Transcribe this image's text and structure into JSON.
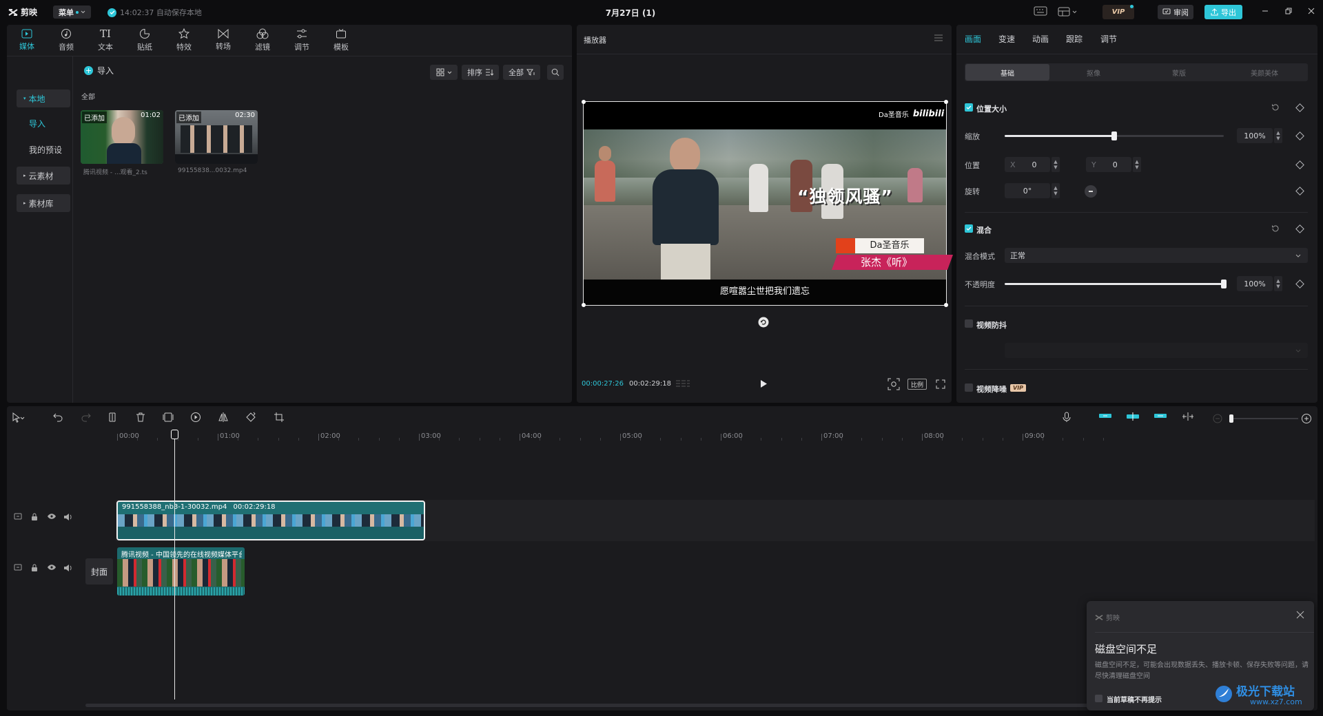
{
  "app": {
    "logo_text": "剪映",
    "menu_label": "菜单",
    "autosave_text": "14:02:37 自动保存本地",
    "project_title": "7月27日 (1)",
    "vip_label": "VIP",
    "review_label": "审阅",
    "export_label": "导出"
  },
  "toolbar": {
    "items": [
      {
        "label": "媒体",
        "icon": "media-icon"
      },
      {
        "label": "音频",
        "icon": "audio-icon"
      },
      {
        "label": "文本",
        "icon": "text-icon"
      },
      {
        "label": "贴纸",
        "icon": "sticker-icon"
      },
      {
        "label": "特效",
        "icon": "effects-icon"
      },
      {
        "label": "转场",
        "icon": "transition-icon"
      },
      {
        "label": "滤镜",
        "icon": "filter-icon"
      },
      {
        "label": "调节",
        "icon": "adjust-icon"
      },
      {
        "label": "模板",
        "icon": "template-icon"
      }
    ]
  },
  "sidebar": {
    "local": "本地",
    "import": "导入",
    "presets": "我的预设",
    "cloud": "云素材",
    "library": "素材库"
  },
  "media": {
    "import_label": "导入",
    "sort_label": "排序",
    "filter_label": "全部",
    "section_label": "全部",
    "items": [
      {
        "badge": "已添加",
        "duration": "01:02",
        "name": "腾讯视频 - ...观看_2.ts"
      },
      {
        "badge": "已添加",
        "duration": "02:30",
        "name": "99155838...0032.mp4"
      }
    ]
  },
  "player": {
    "title": "播放器",
    "current_time": "00:00:27:26",
    "total_time": "00:02:29:18",
    "ratio_label": "比例",
    "watermark_brand": "Da圣音乐",
    "watermark_site": "bilibili",
    "caption_main": "“独领风骚”",
    "caption_brand": "Da圣音乐",
    "caption_song": "张杰《听》",
    "subtitle": "愿喧嚣尘世把我们遗忘"
  },
  "props": {
    "tabs": [
      "画面",
      "变速",
      "动画",
      "跟踪",
      "调节"
    ],
    "subtabs": [
      "基础",
      "抠像",
      "蒙版",
      "美颜美体"
    ],
    "position_size": {
      "title": "位置大小",
      "scale_label": "缩放",
      "scale_value": "100%",
      "scale_level": 0.5,
      "pos_label": "位置",
      "x_label": "X",
      "x_value": "0",
      "y_label": "Y",
      "y_value": "0",
      "rot_label": "旋转",
      "rot_value": "0°"
    },
    "blend": {
      "title": "混合",
      "mode_label": "混合模式",
      "mode_value": "正常",
      "opacity_label": "不透明度",
      "opacity_value": "100%",
      "opacity_level": 1.0
    },
    "stabilize_label": "视频防抖",
    "denoise_label": "视频降噪",
    "denoise_badge": "VIP"
  },
  "timeline": {
    "ticks": [
      "00:00",
      "01:00",
      "02:00",
      "03:00",
      "04:00",
      "05:00",
      "06:00",
      "07:00",
      "08:00",
      "09:00"
    ],
    "clip1": {
      "name": "991558388_nb3-1-30032.mp4",
      "duration": "00:02:29:18"
    },
    "clip2": {
      "name": "腾讯视频 - 中国领先的在线视频媒体平台"
    },
    "cover_label": "封面"
  },
  "toast": {
    "brand": "剪映",
    "title": "磁盘空间不足",
    "body": "磁盘空间不足，可能会出现数据丢失、播放卡顿、保存失败等问题，请尽快清理磁盘空间",
    "checkbox_label": "当前草稿不再提示"
  },
  "watermark": {
    "text": "极光下载站",
    "url": "www.xz7.com"
  },
  "colors": {
    "accent": "#2ec6d8",
    "bg": "#0d0d0f",
    "panel": "#1b1b1e",
    "clip_teal": "#1e6d72"
  }
}
